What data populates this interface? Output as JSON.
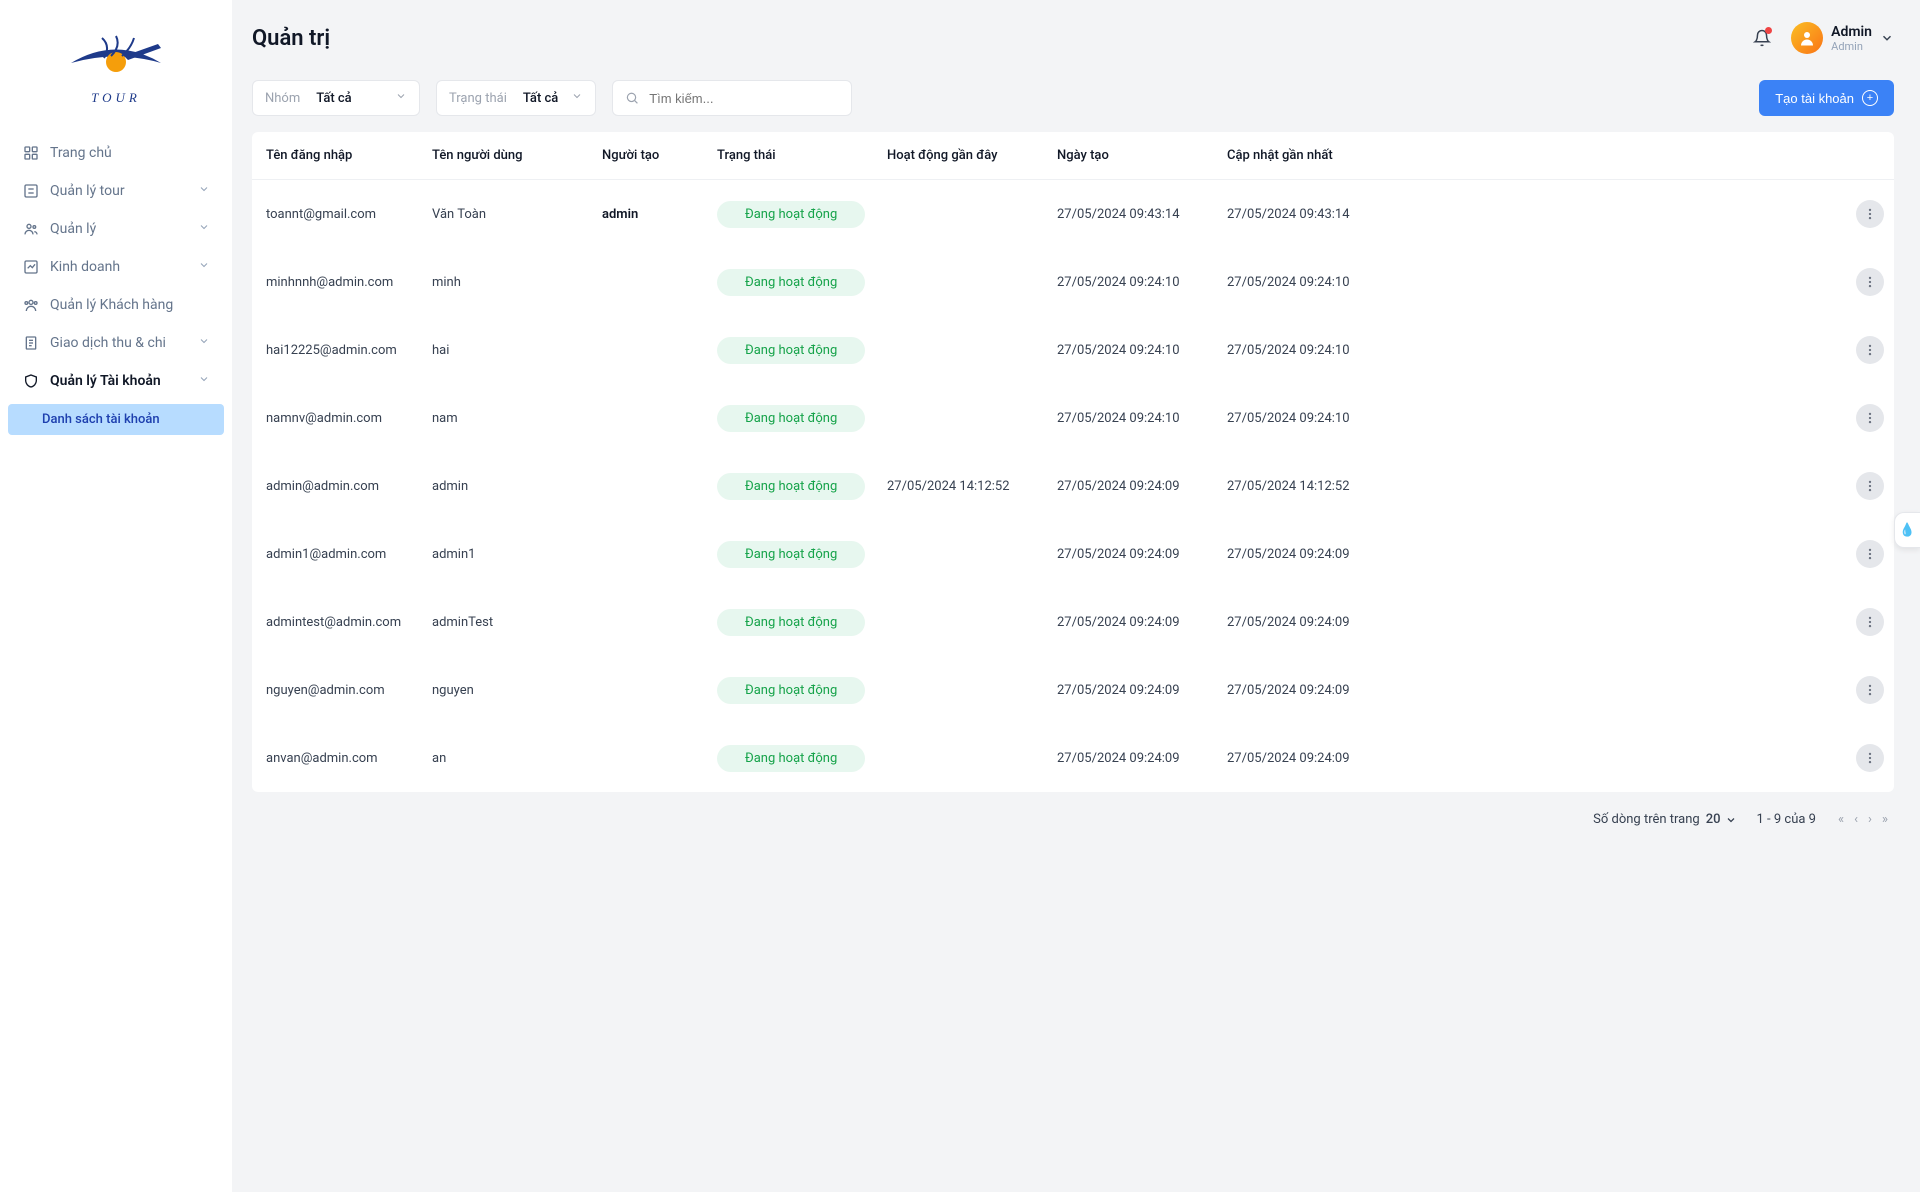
{
  "app": {
    "logo_name": "TOUR"
  },
  "sidebar": {
    "items": [
      {
        "label": "Trang chủ",
        "icon": "grid-icon",
        "expandable": false,
        "active": false
      },
      {
        "label": "Quản lý tour",
        "icon": "square-list-icon",
        "expandable": true,
        "active": false
      },
      {
        "label": "Quản lý",
        "icon": "users-icon",
        "expandable": true,
        "active": false
      },
      {
        "label": "Kinh doanh",
        "icon": "chart-icon",
        "expandable": true,
        "active": false
      },
      {
        "label": "Quản lý Khách hàng",
        "icon": "user-group-icon",
        "expandable": false,
        "active": false
      },
      {
        "label": "Giao dịch thu & chi",
        "icon": "receipt-icon",
        "expandable": true,
        "active": false
      },
      {
        "label": "Quản lý Tài khoản",
        "icon": "shield-icon",
        "expandable": true,
        "active": true
      }
    ],
    "active_sub": {
      "label": "Danh sách tài khoản"
    }
  },
  "header": {
    "title": "Quản trị",
    "user_name": "Admin",
    "user_role": "Admin"
  },
  "filters": {
    "group": {
      "label": "Nhóm",
      "value": "Tất cả"
    },
    "status": {
      "label": "Trạng thái",
      "value": "Tất cả"
    },
    "search_placeholder": "Tìm kiếm...",
    "create_label": "Tạo tài khoản"
  },
  "table": {
    "headers": [
      "Tên đăng nhập",
      "Tên người dùng",
      "Người tạo",
      "Trạng thái",
      "Hoạt động gần đây",
      "Ngày tạo",
      "Cập nhật gần nhất"
    ],
    "status_active": "Đang hoạt động",
    "rows": [
      {
        "login": "toannt@gmail.com",
        "name": "Văn Toàn",
        "creator": "admin",
        "status": "active",
        "last": "",
        "created": "27/05/2024 09:43:14",
        "updated": "27/05/2024 09:43:14"
      },
      {
        "login": "minhnnh@admin.com",
        "name": "minh",
        "creator": "",
        "status": "active",
        "last": "",
        "created": "27/05/2024 09:24:10",
        "updated": "27/05/2024 09:24:10"
      },
      {
        "login": "hai12225@admin.com",
        "name": "hai",
        "creator": "",
        "status": "active",
        "last": "",
        "created": "27/05/2024 09:24:10",
        "updated": "27/05/2024 09:24:10"
      },
      {
        "login": "namnv@admin.com",
        "name": "nam",
        "creator": "",
        "status": "active",
        "last": "",
        "created": "27/05/2024 09:24:10",
        "updated": "27/05/2024 09:24:10"
      },
      {
        "login": "admin@admin.com",
        "name": "admin",
        "creator": "",
        "status": "active",
        "last": "27/05/2024 14:12:52",
        "created": "27/05/2024 09:24:09",
        "updated": "27/05/2024 14:12:52"
      },
      {
        "login": "admin1@admin.com",
        "name": "admin1",
        "creator": "",
        "status": "active",
        "last": "",
        "created": "27/05/2024 09:24:09",
        "updated": "27/05/2024 09:24:09"
      },
      {
        "login": "admintest@admin.com",
        "name": "adminTest",
        "creator": "",
        "status": "active",
        "last": "",
        "created": "27/05/2024 09:24:09",
        "updated": "27/05/2024 09:24:09"
      },
      {
        "login": "nguyen@admin.com",
        "name": "nguyen",
        "creator": "",
        "status": "active",
        "last": "",
        "created": "27/05/2024 09:24:09",
        "updated": "27/05/2024 09:24:09"
      },
      {
        "login": "anvan@admin.com",
        "name": "an",
        "creator": "",
        "status": "active",
        "last": "",
        "created": "27/05/2024 09:24:09",
        "updated": "27/05/2024 09:24:09"
      }
    ]
  },
  "pagination": {
    "rows_label": "Số dòng trên trang",
    "rows_value": "20",
    "range_text": "1 - 9 của 9"
  }
}
